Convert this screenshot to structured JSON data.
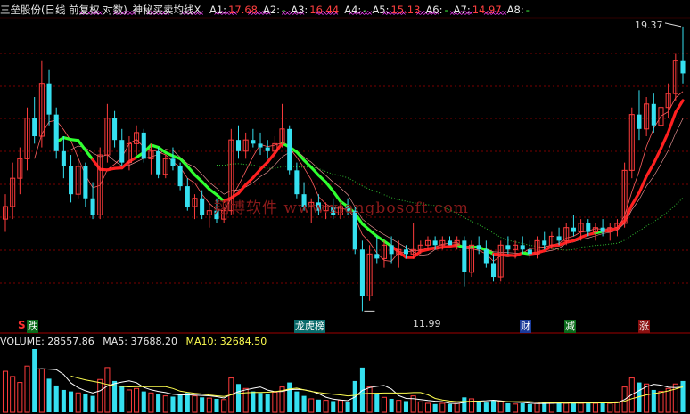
{
  "header": {
    "title": "三垒股份(日线 前复权 对数)",
    "indicator": "神秘买卖均线X",
    "fields": [
      {
        "label": "A1:",
        "value": "17.68",
        "color": "#ff4040"
      },
      {
        "label": "A2:",
        "value": "-",
        "color": "#40ff40"
      },
      {
        "label": "A3:",
        "value": "16.44",
        "color": "#ff4040"
      },
      {
        "label": "A4:",
        "value": "-",
        "color": "#40ff40"
      },
      {
        "label": "A5:",
        "value": "15.13",
        "color": "#ff4040"
      },
      {
        "label": "A6:",
        "value": "-",
        "color": "#40ff40"
      },
      {
        "label": "A7:",
        "value": "14.97",
        "color": "#ff4040"
      },
      {
        "label": "A8:",
        "value": "-",
        "color": "#40ff40"
      }
    ]
  },
  "volume_header": {
    "volume_label": "VOLUME:",
    "volume_value": "28557.86",
    "ma5_label": "MA5:",
    "ma5_value": "37688.20",
    "ma10_label": "MA10:",
    "ma10_value": "32684.50"
  },
  "annotations": {
    "high_label": "19.37",
    "low_label": "11.99",
    "watermark": "翔博软件 www.xiangbosoft.com",
    "s_marker": "S"
  },
  "events": [
    {
      "label": "跌",
      "color": "#ffffff",
      "bg": "#0a6b1a"
    },
    {
      "label": "龙虎榜",
      "color": "#ffffff",
      "bg": "#0a6b6b"
    },
    {
      "label": "财",
      "color": "#ffffff",
      "bg": "#1a3a9a"
    },
    {
      "label": "减",
      "color": "#ffffff",
      "bg": "#0a6b1a"
    },
    {
      "label": "涨",
      "color": "#ffffff",
      "bg": "#8a1010"
    }
  ],
  "colors": {
    "up": "#ff3c3c",
    "down": "#35e0f0",
    "buy_line": "#ff2020",
    "sell_line": "#30ff30",
    "ma_dotted": "#30c030",
    "grid": "#7a0000",
    "vol_ma5": "#ffffff",
    "vol_ma10": "#ffff50"
  },
  "chart_data": {
    "type": "candlestick",
    "scale": "log",
    "title": "三垒股份(日线 前复权 对数)",
    "price_high": 19.37,
    "price_low": 11.99,
    "indicator_values": {
      "A1": 17.68,
      "A3": 16.44,
      "A5": 15.13,
      "A7": 14.97
    },
    "volume": {
      "last": 28557.86,
      "ma5": 37688.2,
      "ma10": 32684.5
    },
    "candles": [
      {
        "o": 14.0,
        "h": 14.6,
        "l": 13.7,
        "c": 14.3
      },
      {
        "o": 14.3,
        "h": 15.4,
        "l": 14.0,
        "c": 15.0
      },
      {
        "o": 15.0,
        "h": 15.8,
        "l": 14.6,
        "c": 15.5
      },
      {
        "o": 15.5,
        "h": 16.9,
        "l": 15.2,
        "c": 16.6
      },
      {
        "o": 16.6,
        "h": 17.2,
        "l": 15.9,
        "c": 16.1
      },
      {
        "o": 16.1,
        "h": 18.3,
        "l": 15.8,
        "c": 17.6
      },
      {
        "o": 17.6,
        "h": 18.0,
        "l": 16.4,
        "c": 16.7
      },
      {
        "o": 16.7,
        "h": 16.9,
        "l": 15.5,
        "c": 15.7
      },
      {
        "o": 15.7,
        "h": 16.1,
        "l": 15.0,
        "c": 15.3
      },
      {
        "o": 15.3,
        "h": 15.6,
        "l": 14.4,
        "c": 14.6
      },
      {
        "o": 14.6,
        "h": 15.5,
        "l": 14.5,
        "c": 15.3
      },
      {
        "o": 15.3,
        "h": 15.4,
        "l": 14.3,
        "c": 14.5
      },
      {
        "o": 14.5,
        "h": 14.9,
        "l": 14.0,
        "c": 14.1
      },
      {
        "o": 14.1,
        "h": 15.8,
        "l": 14.0,
        "c": 15.6
      },
      {
        "o": 15.6,
        "h": 17.0,
        "l": 15.4,
        "c": 16.6
      },
      {
        "o": 16.6,
        "h": 16.8,
        "l": 15.8,
        "c": 16.0
      },
      {
        "o": 16.0,
        "h": 16.3,
        "l": 15.3,
        "c": 15.4
      },
      {
        "o": 15.4,
        "h": 16.1,
        "l": 15.2,
        "c": 15.9
      },
      {
        "o": 15.9,
        "h": 16.4,
        "l": 15.6,
        "c": 16.2
      },
      {
        "o": 16.2,
        "h": 16.3,
        "l": 15.4,
        "c": 15.5
      },
      {
        "o": 15.5,
        "h": 15.9,
        "l": 15.1,
        "c": 15.7
      },
      {
        "o": 15.7,
        "h": 15.8,
        "l": 15.0,
        "c": 15.1
      },
      {
        "o": 15.1,
        "h": 15.6,
        "l": 15.0,
        "c": 15.5
      },
      {
        "o": 15.5,
        "h": 15.8,
        "l": 15.2,
        "c": 15.3
      },
      {
        "o": 15.3,
        "h": 15.4,
        "l": 14.7,
        "c": 14.8
      },
      {
        "o": 14.8,
        "h": 15.0,
        "l": 14.2,
        "c": 14.3
      },
      {
        "o": 14.3,
        "h": 14.6,
        "l": 14.0,
        "c": 14.5
      },
      {
        "o": 14.5,
        "h": 14.7,
        "l": 14.0,
        "c": 14.1
      },
      {
        "o": 14.1,
        "h": 14.4,
        "l": 13.8,
        "c": 14.2
      },
      {
        "o": 14.2,
        "h": 14.5,
        "l": 13.9,
        "c": 14.0
      },
      {
        "o": 14.0,
        "h": 14.3,
        "l": 13.9,
        "c": 14.2
      },
      {
        "o": 14.2,
        "h": 16.3,
        "l": 14.1,
        "c": 16.0
      },
      {
        "o": 16.0,
        "h": 16.4,
        "l": 15.5,
        "c": 15.7
      },
      {
        "o": 15.7,
        "h": 16.2,
        "l": 15.5,
        "c": 16.0
      },
      {
        "o": 16.0,
        "h": 16.3,
        "l": 15.8,
        "c": 15.9
      },
      {
        "o": 15.9,
        "h": 16.2,
        "l": 15.6,
        "c": 15.8
      },
      {
        "o": 15.8,
        "h": 16.0,
        "l": 15.5,
        "c": 15.7
      },
      {
        "o": 15.7,
        "h": 16.1,
        "l": 15.5,
        "c": 15.9
      },
      {
        "o": 15.9,
        "h": 17.0,
        "l": 15.8,
        "c": 16.3
      },
      {
        "o": 16.3,
        "h": 16.4,
        "l": 15.1,
        "c": 15.2
      },
      {
        "o": 15.2,
        "h": 15.4,
        "l": 14.5,
        "c": 14.6
      },
      {
        "o": 14.6,
        "h": 14.9,
        "l": 14.2,
        "c": 14.3
      },
      {
        "o": 14.3,
        "h": 14.5,
        "l": 13.9,
        "c": 14.4
      },
      {
        "o": 14.4,
        "h": 14.6,
        "l": 14.1,
        "c": 14.2
      },
      {
        "o": 14.2,
        "h": 14.4,
        "l": 14.0,
        "c": 14.3
      },
      {
        "o": 14.3,
        "h": 14.5,
        "l": 14.0,
        "c": 14.1
      },
      {
        "o": 14.1,
        "h": 14.4,
        "l": 14.0,
        "c": 14.3
      },
      {
        "o": 14.3,
        "h": 14.5,
        "l": 14.1,
        "c": 14.2
      },
      {
        "o": 14.2,
        "h": 14.3,
        "l": 13.2,
        "c": 13.3
      },
      {
        "o": 13.3,
        "h": 13.5,
        "l": 11.99,
        "c": 12.3
      },
      {
        "o": 12.3,
        "h": 13.4,
        "l": 12.2,
        "c": 13.2
      },
      {
        "o": 13.2,
        "h": 13.6,
        "l": 13.0,
        "c": 13.1
      },
      {
        "o": 13.1,
        "h": 13.5,
        "l": 12.9,
        "c": 13.4
      },
      {
        "o": 13.4,
        "h": 13.6,
        "l": 13.0,
        "c": 13.2
      },
      {
        "o": 13.2,
        "h": 13.5,
        "l": 12.9,
        "c": 13.3
      },
      {
        "o": 13.3,
        "h": 13.4,
        "l": 13.1,
        "c": 13.2
      },
      {
        "o": 13.2,
        "h": 13.9,
        "l": 13.1,
        "c": 13.3
      },
      {
        "o": 13.3,
        "h": 13.5,
        "l": 13.2,
        "c": 13.4
      },
      {
        "o": 13.4,
        "h": 13.6,
        "l": 13.3,
        "c": 13.5
      },
      {
        "o": 13.5,
        "h": 13.6,
        "l": 13.3,
        "c": 13.4
      },
      {
        "o": 13.4,
        "h": 13.6,
        "l": 13.3,
        "c": 13.5
      },
      {
        "o": 13.5,
        "h": 13.6,
        "l": 13.4,
        "c": 13.4
      },
      {
        "o": 13.4,
        "h": 13.6,
        "l": 13.3,
        "c": 13.5
      },
      {
        "o": 13.5,
        "h": 13.6,
        "l": 12.5,
        "c": 12.8
      },
      {
        "o": 12.8,
        "h": 13.5,
        "l": 12.7,
        "c": 13.4
      },
      {
        "o": 13.4,
        "h": 13.6,
        "l": 13.2,
        "c": 13.3
      },
      {
        "o": 13.3,
        "h": 13.5,
        "l": 12.9,
        "c": 13.0
      },
      {
        "o": 13.0,
        "h": 13.2,
        "l": 12.6,
        "c": 12.7
      },
      {
        "o": 12.7,
        "h": 13.5,
        "l": 12.6,
        "c": 13.4
      },
      {
        "o": 13.4,
        "h": 13.6,
        "l": 13.2,
        "c": 13.3
      },
      {
        "o": 13.3,
        "h": 13.5,
        "l": 13.1,
        "c": 13.4
      },
      {
        "o": 13.4,
        "h": 13.6,
        "l": 13.2,
        "c": 13.3
      },
      {
        "o": 13.3,
        "h": 13.5,
        "l": 13.1,
        "c": 13.2
      },
      {
        "o": 13.2,
        "h": 13.6,
        "l": 13.1,
        "c": 13.5
      },
      {
        "o": 13.5,
        "h": 13.7,
        "l": 13.3,
        "c": 13.4
      },
      {
        "o": 13.4,
        "h": 13.7,
        "l": 13.3,
        "c": 13.6
      },
      {
        "o": 13.6,
        "h": 13.8,
        "l": 13.4,
        "c": 13.5
      },
      {
        "o": 13.5,
        "h": 13.9,
        "l": 13.4,
        "c": 13.8
      },
      {
        "o": 13.8,
        "h": 14.1,
        "l": 13.6,
        "c": 13.7
      },
      {
        "o": 13.7,
        "h": 14.0,
        "l": 13.5,
        "c": 13.9
      },
      {
        "o": 13.9,
        "h": 14.0,
        "l": 13.6,
        "c": 13.7
      },
      {
        "o": 13.7,
        "h": 13.9,
        "l": 13.5,
        "c": 13.8
      },
      {
        "o": 13.8,
        "h": 14.0,
        "l": 13.6,
        "c": 13.7
      },
      {
        "o": 13.7,
        "h": 13.9,
        "l": 13.5,
        "c": 13.8
      },
      {
        "o": 13.8,
        "h": 14.0,
        "l": 13.6,
        "c": 13.9
      },
      {
        "o": 13.9,
        "h": 15.4,
        "l": 13.8,
        "c": 15.2
      },
      {
        "o": 15.2,
        "h": 16.9,
        "l": 15.0,
        "c": 16.7
      },
      {
        "o": 16.7,
        "h": 17.4,
        "l": 16.0,
        "c": 16.3
      },
      {
        "o": 16.3,
        "h": 17.2,
        "l": 16.1,
        "c": 17.0
      },
      {
        "o": 17.0,
        "h": 17.3,
        "l": 16.2,
        "c": 16.4
      },
      {
        "o": 16.4,
        "h": 17.1,
        "l": 16.3,
        "c": 16.9
      },
      {
        "o": 16.9,
        "h": 17.6,
        "l": 16.6,
        "c": 17.3
      },
      {
        "o": 17.3,
        "h": 18.5,
        "l": 17.1,
        "c": 18.3
      },
      {
        "o": 18.3,
        "h": 19.37,
        "l": 17.6,
        "c": 17.9
      }
    ],
    "volumes": [
      55,
      48,
      40,
      62,
      85,
      58,
      45,
      36,
      30,
      28,
      26,
      24,
      22,
      44,
      60,
      42,
      35,
      30,
      32,
      28,
      26,
      24,
      22,
      21,
      24,
      26,
      22,
      20,
      19,
      18,
      17,
      46,
      38,
      32,
      28,
      26,
      25,
      27,
      34,
      40,
      28,
      22,
      18,
      17,
      16,
      15,
      16,
      14,
      42,
      60,
      34,
      24,
      20,
      18,
      16,
      15,
      22,
      14,
      12,
      11,
      12,
      11,
      12,
      20,
      18,
      14,
      13,
      16,
      15,
      12,
      11,
      12,
      11,
      12,
      13,
      12,
      13,
      12,
      14,
      12,
      13,
      12,
      13,
      12,
      14,
      34,
      46,
      40,
      38,
      30,
      28,
      32,
      38,
      42
    ]
  }
}
